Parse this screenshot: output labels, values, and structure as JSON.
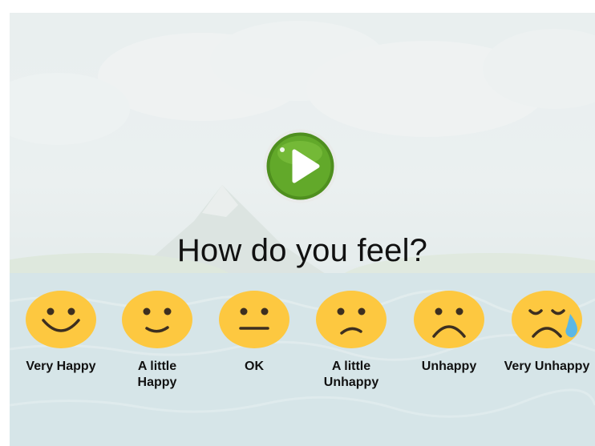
{
  "question": "How do you feel?",
  "play_button": {
    "icon": "play-icon",
    "color": "#5fa528"
  },
  "face_color": "#fdc840",
  "options": [
    {
      "label": "Very Happy",
      "icon": "very-happy-face-icon"
    },
    {
      "label": "A little\nHappy",
      "icon": "a-little-happy-face-icon"
    },
    {
      "label": "OK",
      "icon": "neutral-face-icon"
    },
    {
      "label": "A little\nUnhappy",
      "icon": "a-little-unhappy-face-icon"
    },
    {
      "label": "Unhappy",
      "icon": "unhappy-face-icon"
    },
    {
      "label": "Very Unhappy",
      "icon": "very-unhappy-crying-face-icon"
    }
  ]
}
